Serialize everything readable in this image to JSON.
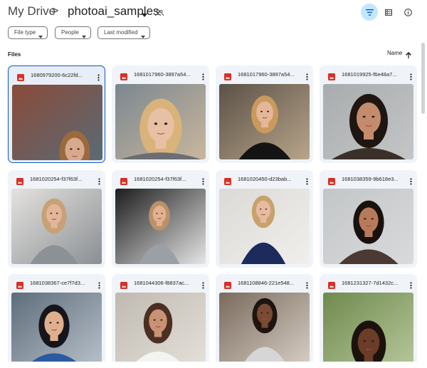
{
  "breadcrumb": {
    "root": "My Drive",
    "separator": ">",
    "current": "photoai_samples"
  },
  "header_icons": [
    "filter-icon",
    "details-view-icon",
    "info-icon"
  ],
  "filters": [
    {
      "label": "File type"
    },
    {
      "label": "People"
    },
    {
      "label": "Last modified"
    }
  ],
  "section": {
    "title": "Files",
    "sort_label": "Name"
  },
  "colors": {
    "accent": "#0b57d0",
    "active_chip_bg": "#c2e7ff",
    "card_bg": "#f0f4f9",
    "image_icon": "#d93025"
  },
  "files": [
    {
      "name": "1680979200-6c22fd...",
      "selected": true,
      "thumb": "man-street"
    },
    {
      "name": "1681017960-3897a54...",
      "selected": false,
      "thumb": "blonde-closeup"
    },
    {
      "name": "1681017960-3897a54...",
      "selected": false,
      "thumb": "blonde-black-top"
    },
    {
      "name": "1681019925-f6e48a7...",
      "selected": false,
      "thumb": "dark-hair-grey"
    },
    {
      "name": "1681020254-f37f63f...",
      "selected": false,
      "thumb": "grey-sweater"
    },
    {
      "name": "1681020254-f37f63f...",
      "selected": false,
      "thumb": "grey-sweater-door"
    },
    {
      "name": "1681020450-d23bab...",
      "selected": false,
      "thumb": "navy-cardigan"
    },
    {
      "name": "1681038359-9b618e3...",
      "selected": false,
      "thumb": "long-dark-hair"
    },
    {
      "name": "1681038367-ce7f7d3...",
      "selected": false,
      "thumb": "man-blue-blazer"
    },
    {
      "name": "1681044306-f8837ac...",
      "selected": false,
      "thumb": "woman-white-top"
    },
    {
      "name": "1681108846-221e548...",
      "selected": false,
      "thumb": "curly-ub-shirt"
    },
    {
      "name": "1681231327-7d1432c...",
      "selected": false,
      "thumb": "afro-hair"
    }
  ]
}
